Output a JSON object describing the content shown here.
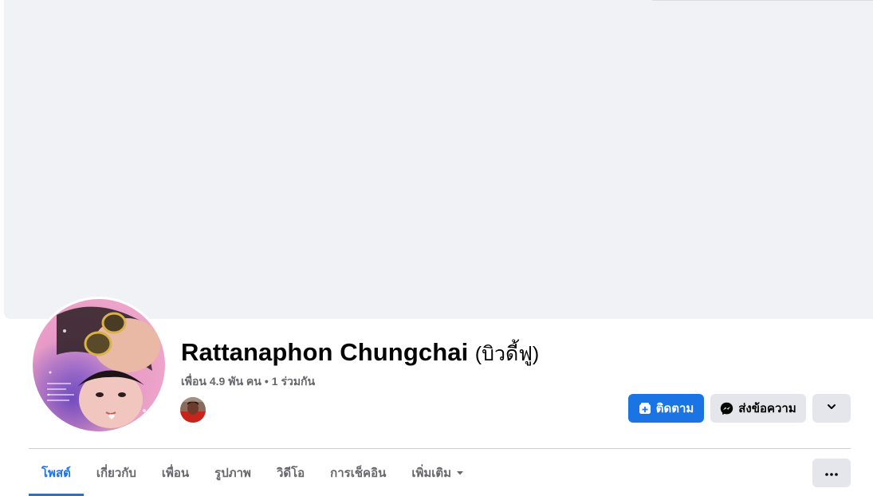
{
  "profile": {
    "name": "Rattanaphon Chungchai",
    "alternate_name": "(บิวดี้ฟู)",
    "friends_text": "เพื่อน 4.9 พัน คน",
    "separator": "•",
    "mutual_text": "1 ร่วมกัน"
  },
  "actions": {
    "follow_label": "ติดตาม",
    "message_label": "ส่งข้อความ"
  },
  "tabs": [
    {
      "label": "โพสต์",
      "active": true
    },
    {
      "label": "เกี่ยวกับ",
      "active": false
    },
    {
      "label": "เพื่อน",
      "active": false
    },
    {
      "label": "รูปภาพ",
      "active": false
    },
    {
      "label": "วิดีโอ",
      "active": false
    },
    {
      "label": "การเช็คอิน",
      "active": false
    },
    {
      "label": "เพิ่มเติม",
      "active": false
    }
  ],
  "icons": {
    "follow": "follow-plus-icon",
    "message": "messenger-icon",
    "dropdown": "chevron-down-icon",
    "more_tab": "caret-down-icon",
    "more_actions": "ellipsis-icon"
  },
  "colors": {
    "accent": "#1b74e4",
    "cover": "#f0f2f5",
    "secondary_button": "#e4e6eb",
    "muted_text": "#65676b"
  }
}
